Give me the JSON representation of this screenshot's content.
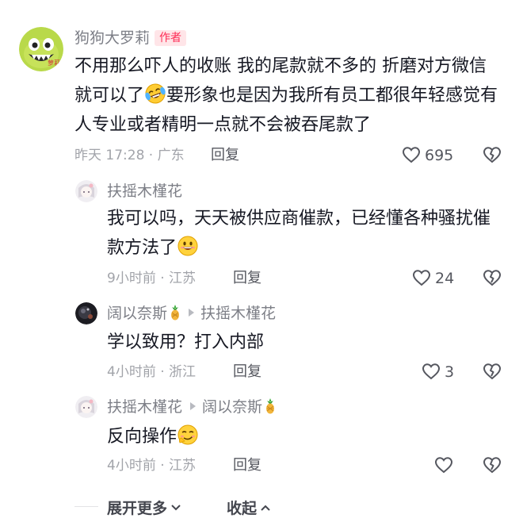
{
  "comments": [
    {
      "author": "狗狗大罗莉",
      "badge": "作者",
      "text_a": "不用那么吓人的收账 我的尾款就不多的 折磨对方微信就可以了",
      "text_b": "要形象也是因为我所有员工都很年轻感觉有人专业或者精明一点就不会被吞尾款了",
      "time_location": "昨天 17:28 · 广东",
      "reply_label": "回复",
      "likes": "695",
      "avatar_text": "萝莉"
    },
    {
      "author": "扶摇木槿花",
      "text_a": "我可以吗，天天被供应商催款，已经懂各种骚扰催款方法了",
      "time_location": "9小时前 · 江苏",
      "reply_label": "回复",
      "likes": "24"
    },
    {
      "author": "阔以奈斯",
      "reply_to": "扶摇木槿花",
      "text_a": "学以致用？打入内部",
      "time_location": "4小时前 · 浙江",
      "reply_label": "回复",
      "likes": "3"
    },
    {
      "author": "扶摇木槿花",
      "reply_to": "阔以奈斯",
      "text_a": "反向操作",
      "time_location": "4小时前 · 江苏",
      "reply_label": "回复",
      "likes": ""
    }
  ],
  "footer": {
    "expand_label": "展开更多",
    "collapse_label": "收起"
  },
  "colors": {
    "accent": "#fe2c55",
    "text": "#161823",
    "meta": "#a2a4aa"
  }
}
